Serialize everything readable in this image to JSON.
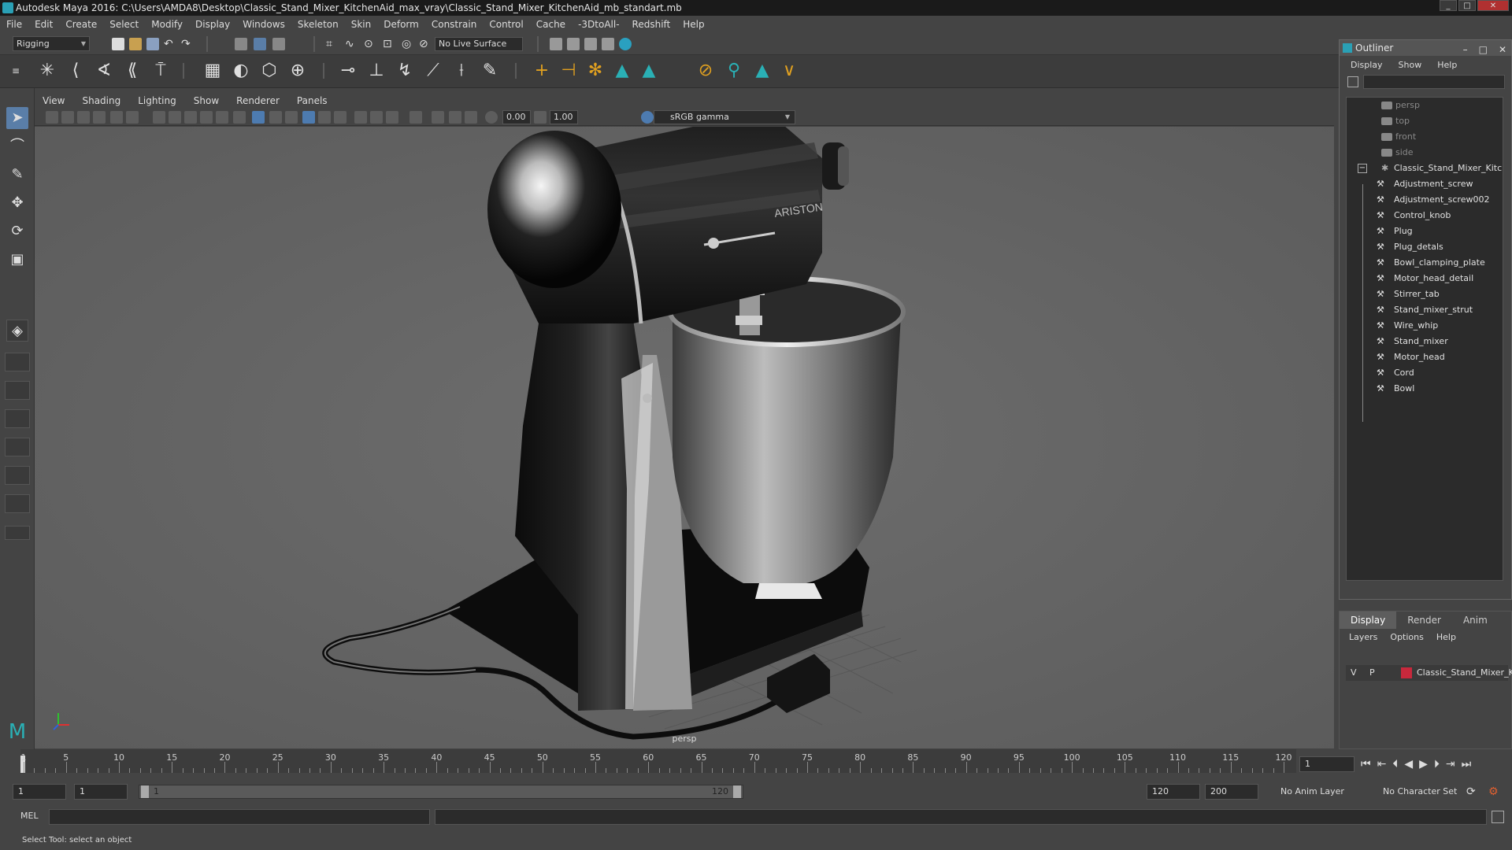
{
  "window": {
    "title": "Autodesk Maya 2016: C:\\Users\\AMDA8\\Desktop\\Classic_Stand_Mixer_KitchenAid_max_vray\\Classic_Stand_Mixer_KitchenAid_mb_standart.mb"
  },
  "menubar": [
    "File",
    "Edit",
    "Create",
    "Select",
    "Modify",
    "Display",
    "Windows",
    "Skeleton",
    "Skin",
    "Deform",
    "Constrain",
    "Control",
    "Cache",
    "-3DtoAll-",
    "Redshift",
    "Help"
  ],
  "toolbar": {
    "mode": "Rigging",
    "live_surface": "No Live Surface"
  },
  "viewport": {
    "menu": [
      "View",
      "Shading",
      "Lighting",
      "Show",
      "Renderer",
      "Panels"
    ],
    "exposure": "0.00",
    "gamma_value": "1.00",
    "color_space": "sRGB gamma",
    "camera": "persp",
    "brand_logo": "ARISTON"
  },
  "outliner": {
    "title": "Outliner",
    "menu": [
      "Display",
      "Show",
      "Help"
    ],
    "cameras": [
      "persp",
      "top",
      "front",
      "side"
    ],
    "group": "Classic_Stand_Mixer_Kitcl",
    "children": [
      "Adjustment_screw",
      "Adjustment_screw002",
      "Control_knob",
      "Plug",
      "Plug_detals",
      "Bowl_clamping_plate",
      "Motor_head_detail",
      "Stirrer_tab",
      "Stand_mixer_strut",
      "Wire_whip",
      "Stand_mixer",
      "Motor_head",
      "Cord",
      "Bowl"
    ]
  },
  "layers": {
    "tabs": [
      "Display",
      "Render",
      "Anim"
    ],
    "menu": [
      "Layers",
      "Options",
      "Help"
    ],
    "row": {
      "v": "V",
      "p": "P",
      "name": "Classic_Stand_Mixer_K",
      "color": "#c8283c"
    }
  },
  "timeline": {
    "ticks": [
      "1",
      "5",
      "10",
      "15",
      "20",
      "25",
      "30",
      "35",
      "40",
      "45",
      "50",
      "55",
      "60",
      "65",
      "70",
      "75",
      "80",
      "85",
      "90",
      "95",
      "100",
      "105",
      "110",
      "115",
      "120"
    ],
    "current_frame": "1",
    "range_start": "1",
    "range_start2": "1",
    "range_inner_start": "1",
    "range_inner_end": "120",
    "range_end": "120",
    "range_end2": "200",
    "anim_layer": "No Anim Layer",
    "char_set": "No Character Set"
  },
  "command": {
    "mel_label": "MEL",
    "help_text": "Select Tool: select an object"
  }
}
